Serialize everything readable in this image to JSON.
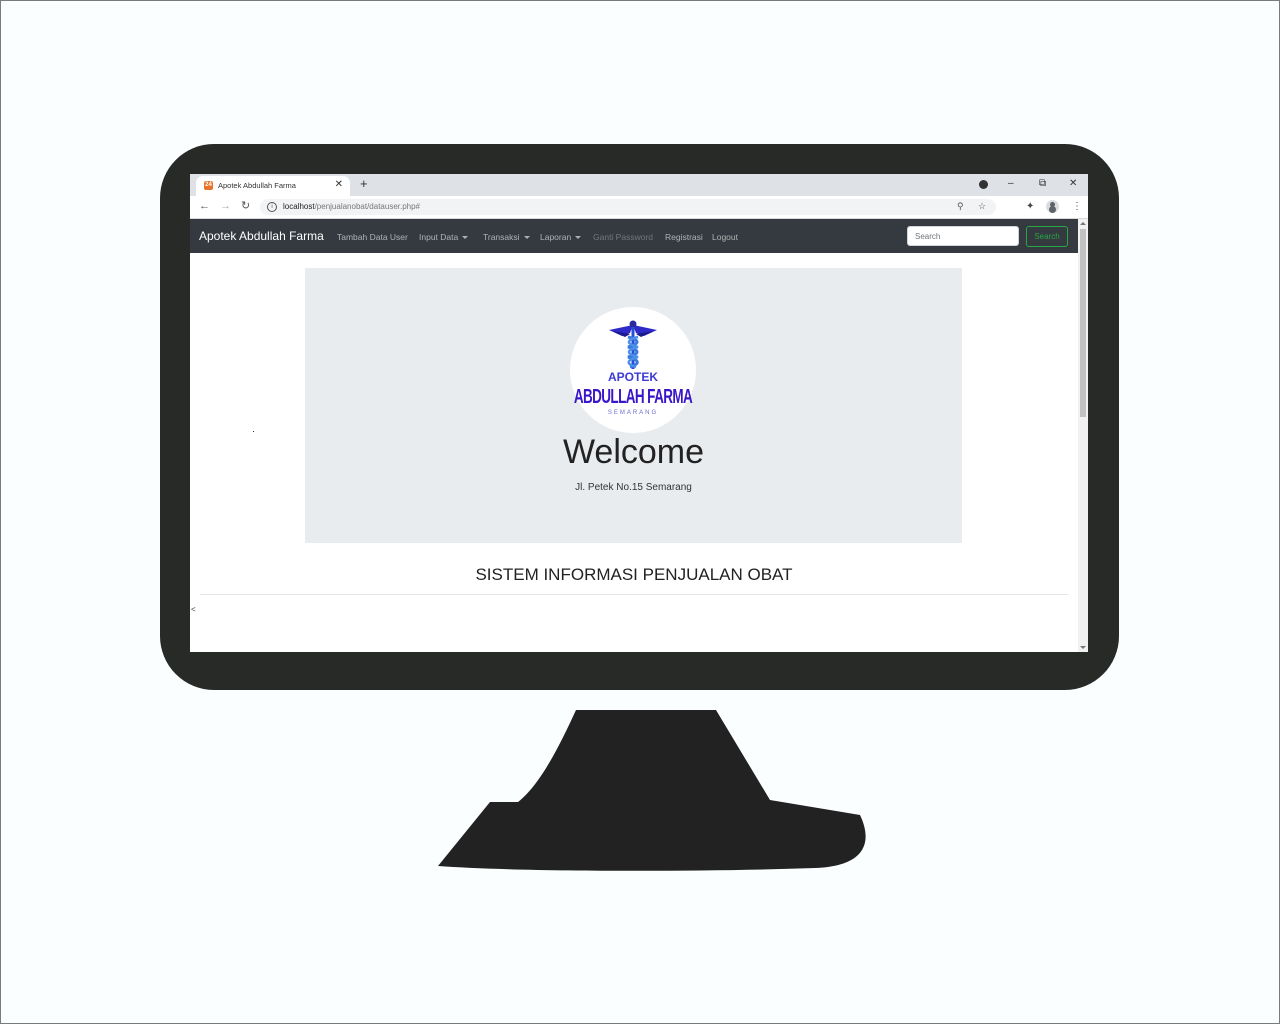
{
  "browser": {
    "tab_title": "Apotek Abdullah Farma",
    "tab_favicon": "24",
    "url_host": "localhost",
    "url_path": "/penjualanobat/datauser.php#",
    "icons": [
      "back-arrow-icon",
      "forward-arrow-icon",
      "reload-icon",
      "info-icon",
      "zoom-icon",
      "star-icon",
      "extensions-icon",
      "profile-icon",
      "menu-icon",
      "download-icon",
      "minimize-icon",
      "restore-icon",
      "close-icon",
      "new-tab-icon"
    ]
  },
  "navbar": {
    "brand": "Apotek Abdullah Farma",
    "links": {
      "tambah": "Tambah Data User",
      "input": "Input Data",
      "transaksi": "Transaksi",
      "laporan": "Laporan",
      "ganti": "Ganti Password",
      "registrasi": "Registrasi",
      "logout": "Logout"
    },
    "search_placeholder": "Search",
    "search_button": "Search"
  },
  "jumbotron": {
    "logo_line1": "APOTEK",
    "logo_line2": "ABDULLAH FARMA",
    "logo_line3": "SEMARANG",
    "heading": "Welcome",
    "address": "Jl. Petek No.15 Semarang"
  },
  "page": {
    "section_title": "SISTEM INFORMASI PENJUALAN OBAT",
    "stray_text": "<"
  },
  "colors": {
    "navbar": "#343a40",
    "jumbotron": "#e9ecef",
    "search_button": "#28a745",
    "logo_text": "#3a16c8",
    "bezel": "#282a28"
  }
}
